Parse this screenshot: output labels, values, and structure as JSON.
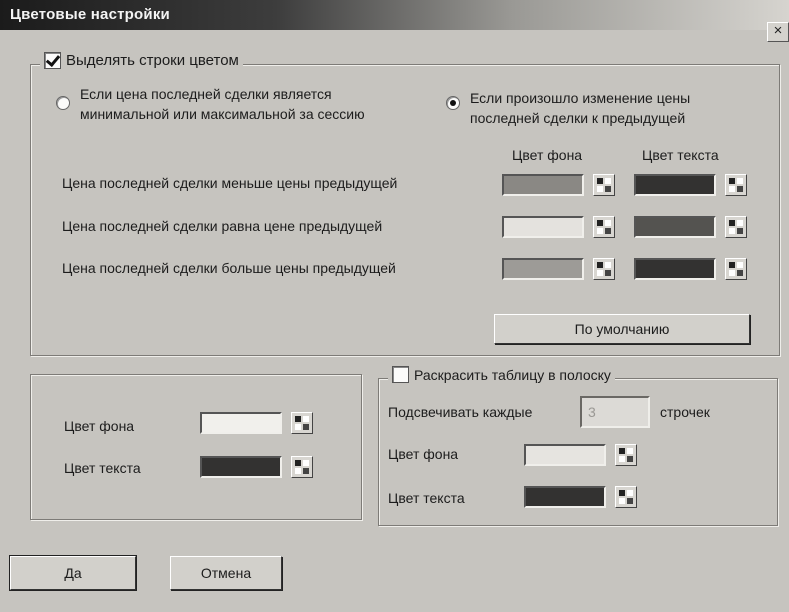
{
  "window": {
    "title": "Цветовые настройки",
    "close_label": "×"
  },
  "highlight_group": {
    "checkbox_label": "Выделять строки цветом",
    "checked": true,
    "radio_min_max": "Если цена последней сделки является\nминимальной или максимальной за сессию",
    "radio_change": "Если произошло изменение цены\nпоследней сделки к предыдущей",
    "selected_radio": "change",
    "col_bg": "Цвет фона",
    "col_text": "Цвет текста",
    "rows": [
      {
        "label": "Цена последней сделки меньше цены предыдущей",
        "bg_color": "#8a8884",
        "text_color": "#333231"
      },
      {
        "label": "Цена последней сделки равна цене предыдущей",
        "bg_color": "#e4e2de",
        "text_color": "#545350"
      },
      {
        "label": "Цена последней сделки больше цены предыдущей",
        "bg_color": "#9d9b97",
        "text_color": "#333231"
      }
    ],
    "default_button": "По умолчанию"
  },
  "general_colors": {
    "bg_label": "Цвет фона",
    "text_label": "Цвет текста",
    "bg_color": "#f1f0ec",
    "text_color": "#333231"
  },
  "stripe_group": {
    "checkbox_label": "Раскрасить таблицу в полоску",
    "checked": false,
    "every_label": "Подсвечивать каждые",
    "every_value": "3",
    "rows_label": "строчек",
    "bg_label": "Цвет фона",
    "text_label": "Цвет текста",
    "bg_color": "#e6e4e0",
    "text_color": "#333231"
  },
  "footer": {
    "ok_label": "Да",
    "cancel_label": "Отмена"
  }
}
